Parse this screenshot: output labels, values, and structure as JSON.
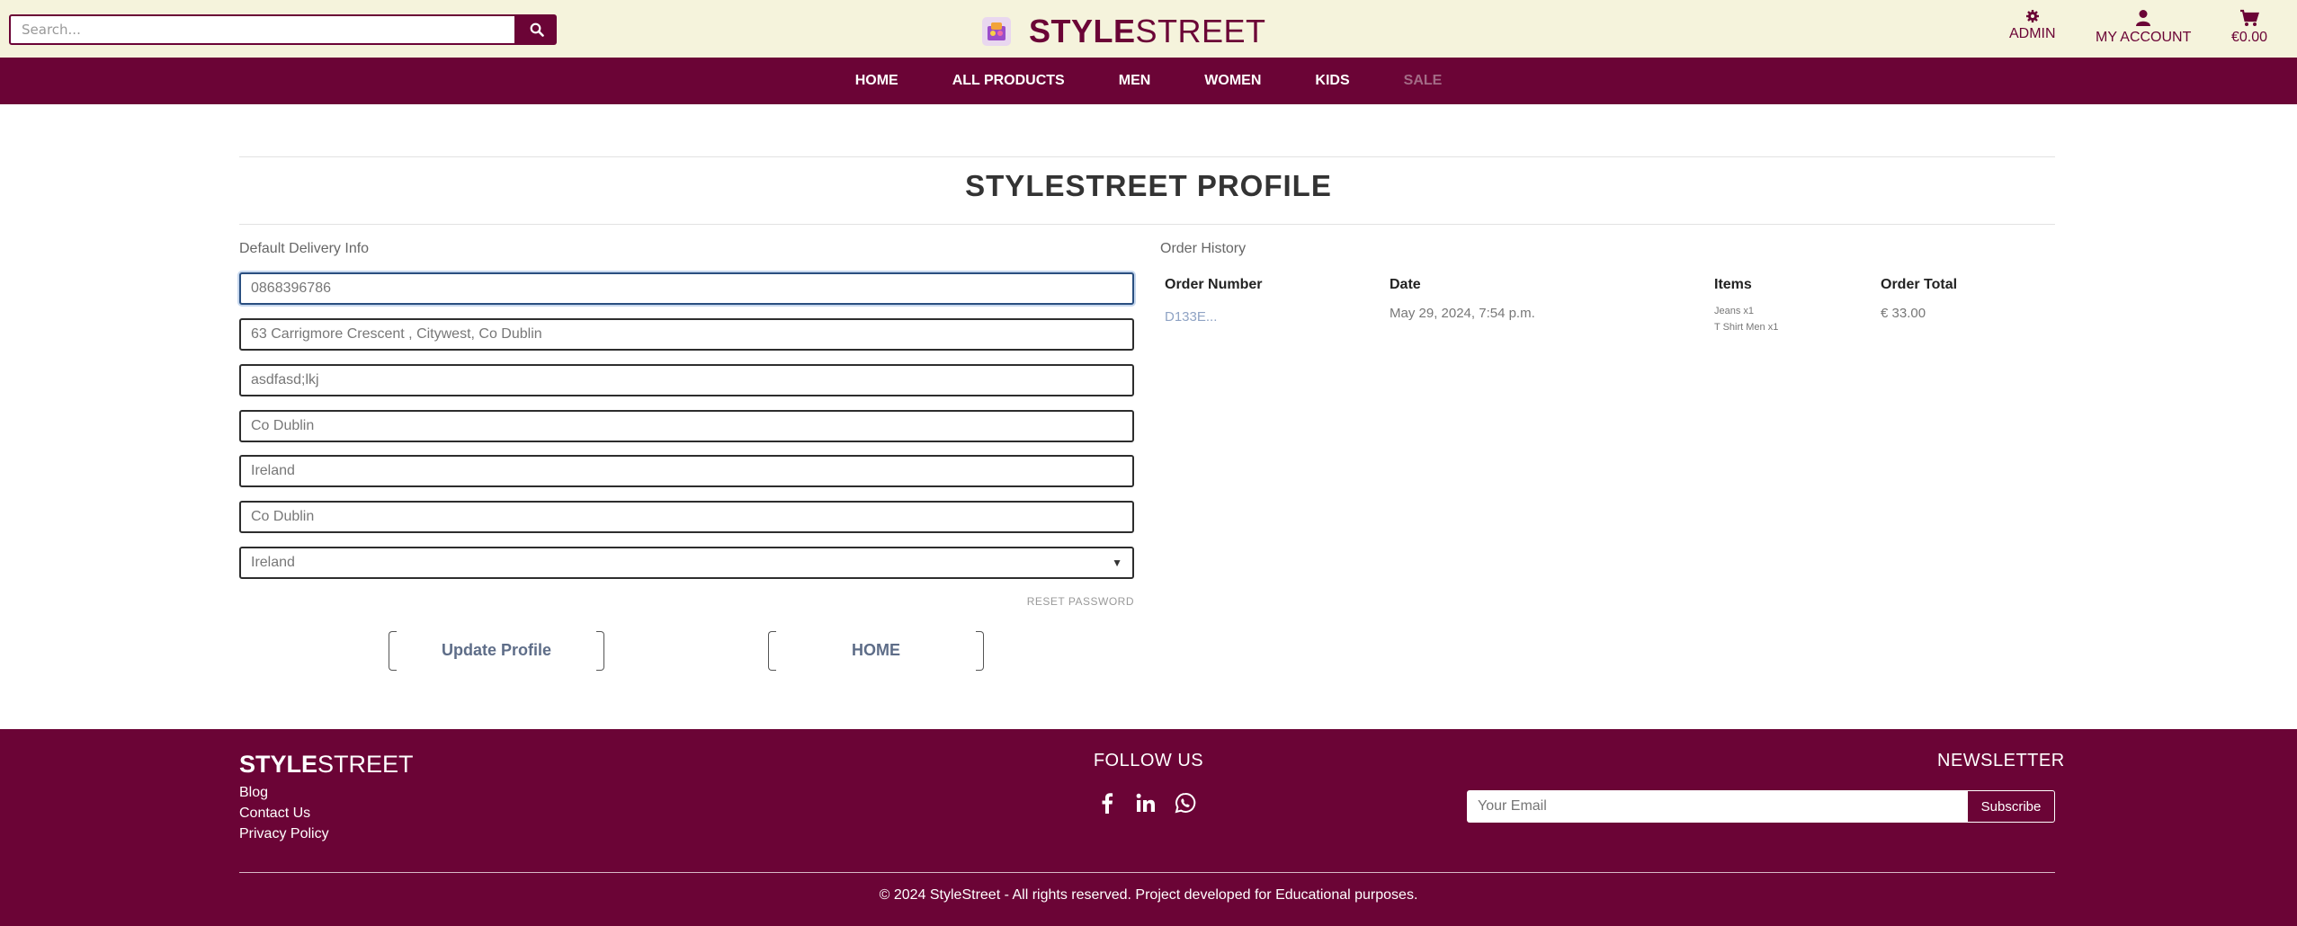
{
  "header": {
    "search_placeholder": "Search...",
    "brand_bold": "STYLE",
    "brand_light": "STREET",
    "admin_label": "ADMIN",
    "account_label": "MY ACCOUNT",
    "cart_total": "€0.00"
  },
  "nav": {
    "items": [
      "HOME",
      "ALL PRODUCTS",
      "MEN",
      "WOMEN",
      "KIDS",
      "SALE"
    ]
  },
  "profile": {
    "title": "STYLESTREET PROFILE",
    "delivery_label": "Default Delivery Info",
    "fields": [
      "0868396786",
      "63 Carrigmore Crescent , Citywest, Co Dublin",
      "asdfasd;lkj",
      "Co Dublin",
      "Ireland",
      "Co Dublin"
    ],
    "country_selected": "Ireland",
    "reset_password": "RESET PASSWORD",
    "update_button": "Update Profile",
    "home_button": "HOME"
  },
  "order_history": {
    "label": "Order History",
    "columns": [
      "Order Number",
      "Date",
      "Items",
      "Order Total"
    ],
    "rows": [
      {
        "number": "D133E...",
        "date": "May 29, 2024, 7:54 p.m.",
        "items": [
          "Jeans x1",
          "T Shirt Men x1"
        ],
        "total": "€ 33.00"
      }
    ]
  },
  "footer": {
    "brand_bold": "STYLE",
    "brand_light": "STREET",
    "links": [
      "Blog",
      "Contact Us",
      "Privacy Policy"
    ],
    "follow_title": "FOLLOW US",
    "newsletter_title": "NEWSLETTER",
    "email_placeholder": "Your Email",
    "subscribe": "Subscribe",
    "copyright": "© 2024 StyleStreet - All rights reserved. Project developed for Educational purposes."
  },
  "colors": {
    "brand": "#6b0436",
    "header_bg": "#f5f3dc"
  },
  "icons": [
    "search-icon",
    "gear-icon",
    "user-icon",
    "cart-icon",
    "facebook-icon",
    "linkedin-icon",
    "whatsapp-icon",
    "chevron-down-icon"
  ]
}
